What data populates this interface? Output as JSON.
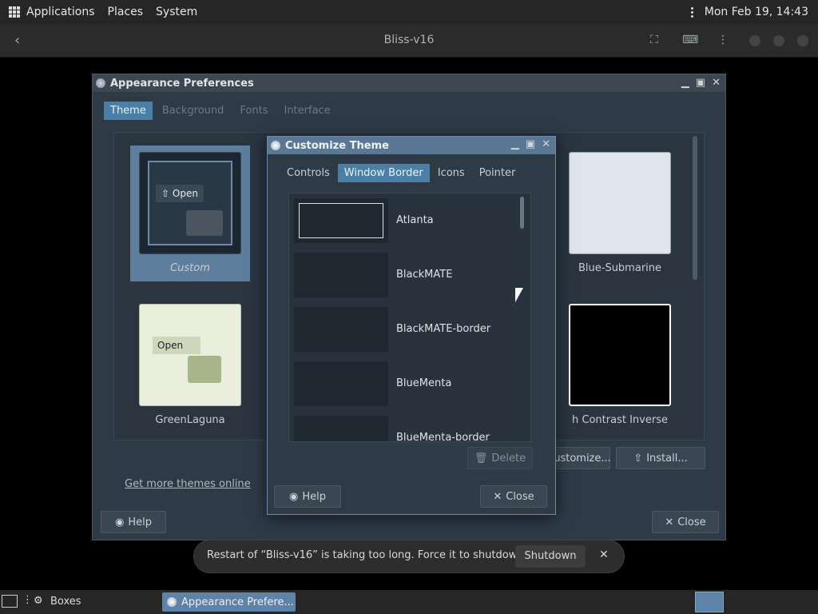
{
  "topbar": {
    "menus": [
      "Applications",
      "Places",
      "System"
    ],
    "clock": "Mon Feb 19, 14:43"
  },
  "boxes": {
    "title": "Bliss-v16"
  },
  "appearance": {
    "title": "Appearance Preferences",
    "tabs": [
      "Theme",
      "Background",
      "Fonts",
      "Interface"
    ],
    "themes": {
      "custom": "Custom",
      "blue_submarine": "Blue-Submarine",
      "greenlaguna": "GreenLaguna",
      "hc_inverse": "h Contrast Inverse"
    },
    "link": "Get more themes online",
    "customize_label": "ustomize...",
    "install_label": "Install...",
    "help_label": "Help",
    "close_label": "Close"
  },
  "customize": {
    "title": "Customize Theme",
    "tabs": [
      "Controls",
      "Window Border",
      "Icons",
      "Pointer"
    ],
    "items": [
      "Atlanta",
      "BlackMATE",
      "BlackMATE-border",
      "BlueMenta",
      "BlueMenta-border"
    ],
    "delete_label": "Delete",
    "help_label": "Help",
    "close_label": "Close"
  },
  "notice": {
    "message": "Restart of “Bliss-v16” is taking too long. Force it to shutdown?",
    "shutdown_label": "Shutdown"
  },
  "taskbar": {
    "boxes": "Boxes",
    "task": "Appearance Prefere..."
  },
  "preview": {
    "open": "Open"
  },
  "colors": {
    "accent": "#4a7fa8",
    "selected_tile": "#5d7e9c"
  }
}
